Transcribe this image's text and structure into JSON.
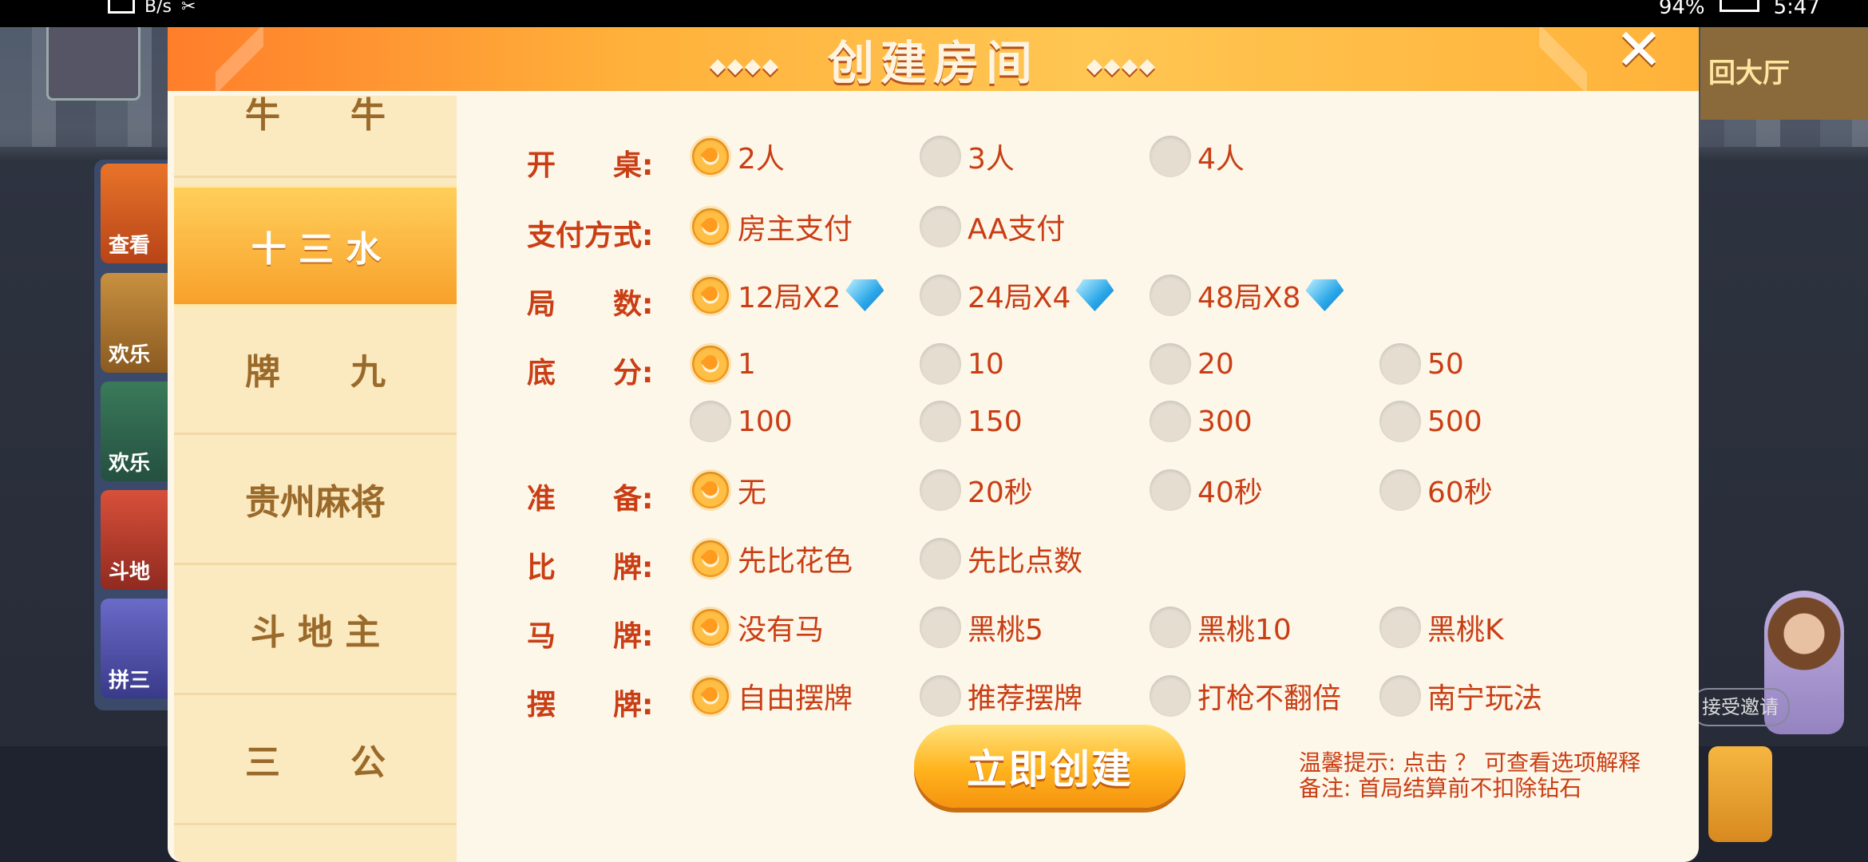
{
  "status_bar": {
    "speed": "B/s",
    "battery": "94%",
    "time": "5:47"
  },
  "background": {
    "hall_label": "回大厅",
    "tiles": [
      "查看",
      "欢乐",
      "欢乐",
      "斗地",
      "拼三"
    ],
    "invite_label": "接受邀请"
  },
  "dialog": {
    "title": "创建房间",
    "title_ornament": "◆◆◆◆",
    "close_symbol": "✕"
  },
  "sidebar": {
    "items": [
      {
        "label": "牛　　牛"
      },
      {
        "label": "十 三 水"
      },
      {
        "label": "牌　　九"
      },
      {
        "label": "贵州麻将"
      },
      {
        "label": "斗 地 主"
      },
      {
        "label": "三　　公"
      }
    ],
    "selected": "十 三 水"
  },
  "options": {
    "tables": {
      "label": "开　　桌:",
      "choices": [
        "2人",
        "3人",
        "4人"
      ],
      "selected": "2人"
    },
    "payment": {
      "label": "支付方式:",
      "choices": [
        "房主支付",
        "AA支付"
      ],
      "selected": "房主支付"
    },
    "rounds": {
      "label": "局　　数:",
      "choices": [
        "12局X2",
        "24局X4",
        "48局X8"
      ],
      "selected": "12局X2",
      "icon": "diamond-icon"
    },
    "base_score": {
      "label": "底　　分:",
      "choices": [
        "1",
        "10",
        "20",
        "50",
        "100",
        "150",
        "300",
        "500"
      ],
      "selected": "1"
    },
    "ready": {
      "label": "准　　备:",
      "choices": [
        "无",
        "20秒",
        "40秒",
        "60秒"
      ],
      "selected": "无"
    },
    "compare": {
      "label": "比　　牌:",
      "choices": [
        "先比花色",
        "先比点数"
      ],
      "selected": "先比花色"
    },
    "horse": {
      "label": "马　　牌:",
      "choices": [
        "没有马",
        "黑桃5",
        "黑桃10",
        "黑桃K"
      ],
      "selected": "没有马"
    },
    "arrange": {
      "label": "摆　　牌:",
      "choices": [
        "自由摆牌",
        "推荐摆牌",
        "打枪不翻倍",
        "南宁玩法"
      ],
      "selected": "自由摆牌"
    }
  },
  "create_button": {
    "label": "立即创建"
  },
  "tips": {
    "line1": "温馨提示: 点击 ？ 可查看选项解释",
    "line2": "备注: 首局结算前不扣除钻石"
  },
  "colors": {
    "accent": "#ff9b1e",
    "text": "#c93e14",
    "panel": "#fdf7ea"
  }
}
